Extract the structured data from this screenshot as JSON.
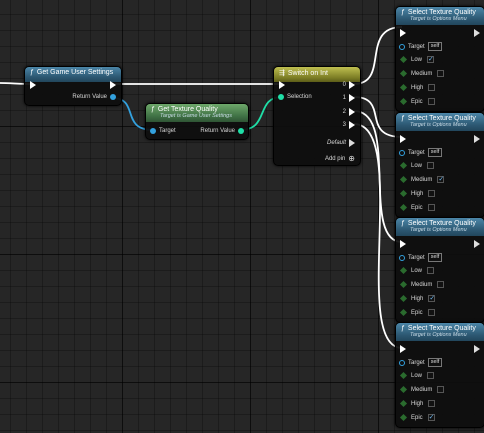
{
  "colors": {
    "object_wire": "#33a1de",
    "int_wire": "#1fdfa7",
    "exec_wire": "#ffffff",
    "enum_pin": "#0a5a1a"
  },
  "get_settings": {
    "icon": "function-icon",
    "title": "Get Game User Settings",
    "return_label": "Return Value"
  },
  "get_quality": {
    "icon": "function-icon",
    "title": "Get Texture Quality",
    "subtitle": "Target is Game User Settings",
    "target_label": "Target",
    "return_label": "Return Value"
  },
  "switch": {
    "icon": "switch-icon",
    "title": "Switch on Int",
    "selection_label": "Selection",
    "cases": [
      "0",
      "1",
      "2",
      "3"
    ],
    "default_label": "Default",
    "add_pin_label": "Add pin"
  },
  "select_nodes": [
    {
      "title": "Select Texture Quality",
      "subtitle": "Target is Options Menu",
      "target_label": "Target",
      "self_label": "self",
      "options": [
        "Low",
        "Medium",
        "High",
        "Epic"
      ],
      "checked": "Low"
    },
    {
      "title": "Select Texture Quality",
      "subtitle": "Target is Options Menu",
      "target_label": "Target",
      "self_label": "self",
      "options": [
        "Low",
        "Medium",
        "High",
        "Epic"
      ],
      "checked": "Medium"
    },
    {
      "title": "Select Texture Quality",
      "subtitle": "Target is Options Menu",
      "target_label": "Target",
      "self_label": "self",
      "options": [
        "Low",
        "Medium",
        "High",
        "Epic"
      ],
      "checked": "High"
    },
    {
      "title": "Select Texture Quality",
      "subtitle": "Target is Options Menu",
      "target_label": "Target",
      "self_label": "self",
      "options": [
        "Low",
        "Medium",
        "High",
        "Epic"
      ],
      "checked": "Epic"
    }
  ]
}
